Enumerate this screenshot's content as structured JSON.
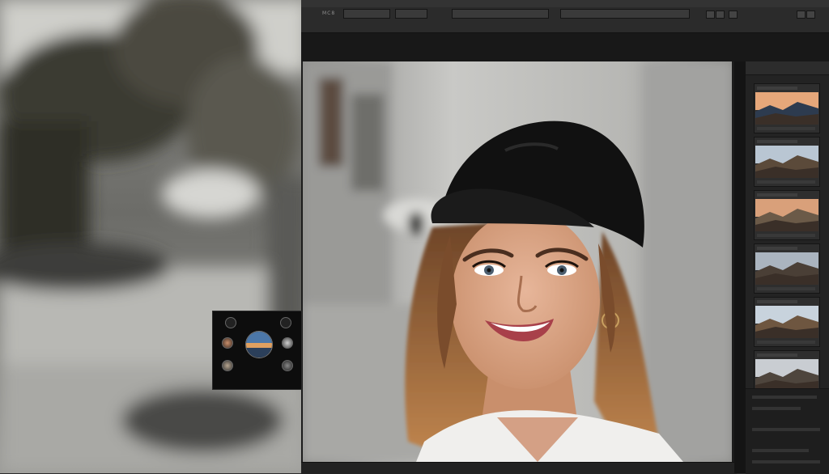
{
  "toolbar": {
    "brand": "MC8",
    "fields": [
      "",
      "",
      "",
      ""
    ],
    "sub_label": ""
  },
  "right_panel": {
    "head_left": "",
    "head_right": "",
    "thumbnail_count": 6,
    "bottom_text_1": "",
    "bottom_text_2": ""
  },
  "bottom_bar": {
    "left": "",
    "mid": ""
  },
  "widget": {
    "title": "",
    "caption": ""
  },
  "colors": {
    "app_bg": "#1c1c1c",
    "toolbar_bg": "#2b2b2b",
    "panel_bg": "#232323",
    "cap": "#151515",
    "hair": "#b07640",
    "skin": "#d9a585"
  },
  "icons": [
    "thumbnail-image-icon",
    "preset-circle-icon",
    "globe-preset-icon"
  ]
}
